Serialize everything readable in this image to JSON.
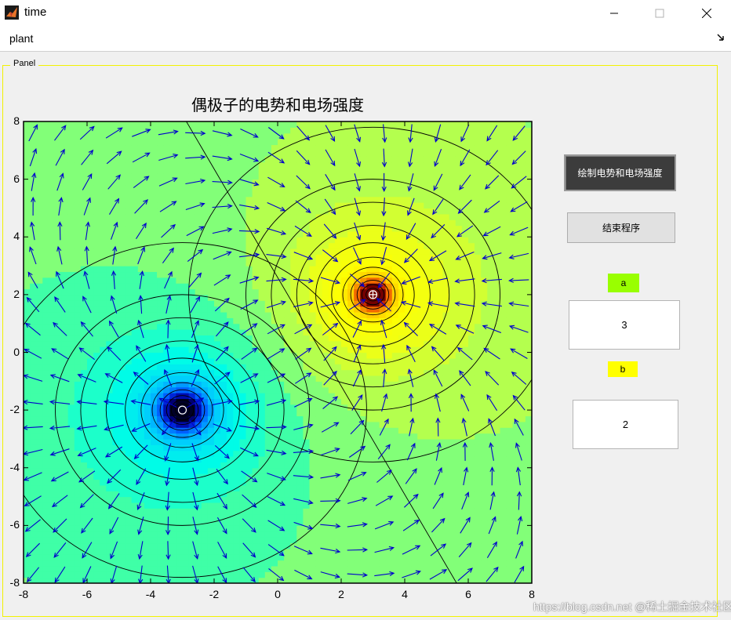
{
  "window": {
    "title": "time",
    "app_icon": "matlab-icon"
  },
  "menu": {
    "items": [
      "plant"
    ]
  },
  "panel": {
    "title": "Panel"
  },
  "plot": {
    "title": "偶极子的电势和电场强度",
    "x_ticks": [
      "-8",
      "-6",
      "-4",
      "-2",
      "0",
      "2",
      "4",
      "6",
      "8"
    ],
    "y_ticks": [
      "8",
      "6",
      "4",
      "2",
      "0",
      "-2",
      "-4",
      "-6",
      "-8"
    ]
  },
  "chart_data": {
    "type": "contour",
    "title": "偶极子的电势和电场强度",
    "xlim": [
      -8,
      8
    ],
    "ylim": [
      -8,
      8
    ],
    "charges": [
      {
        "x": 3,
        "y": 2,
        "sign": "positive",
        "marker": "circle-plus"
      },
      {
        "x": -3,
        "y": -2,
        "sign": "negative",
        "marker": "circle"
      }
    ],
    "overlay": "quiver",
    "quiver_color": "#0000cc",
    "colormap": "jet"
  },
  "controls": {
    "draw_button": "绘制电势和电场强度",
    "exit_button": "结束程序",
    "label_a": "a",
    "label_b": "b",
    "value_a": "3",
    "value_b": "2"
  },
  "watermark": "https://blog.csdn.net  @稀土掘金技术社区"
}
